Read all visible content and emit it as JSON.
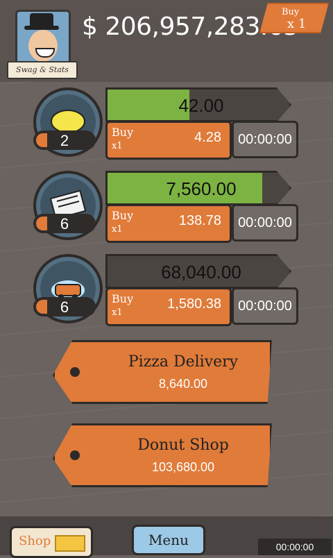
{
  "header": {
    "money": "$ 206,957,283.65",
    "swag_label": "Swag & Stats",
    "buy_multiplier": {
      "label": "Buy",
      "value": "x 1"
    }
  },
  "businesses": [
    {
      "name": "lemon",
      "owned": "2",
      "revenue": "42.00",
      "progress": 0.45,
      "buy_label": "Buy",
      "buy_mult": "x1",
      "cost": "4.28",
      "timer": "00:00:00"
    },
    {
      "name": "newspaper",
      "owned": "6",
      "revenue": "7,560.00",
      "progress": 0.85,
      "buy_label": "Buy",
      "buy_mult": "x1",
      "cost": "138.78",
      "timer": "00:00:00"
    },
    {
      "name": "car-wash",
      "owned": "6",
      "revenue": "68,040.00",
      "progress": 0.0,
      "buy_label": "Buy",
      "buy_mult": "x1",
      "cost": "1,580.38",
      "timer": "00:00:00"
    }
  ],
  "unlockables": [
    {
      "title": "Pizza Delivery",
      "price": "8,640.00"
    },
    {
      "title": "Donut Shop",
      "price": "103,680.00"
    }
  ],
  "footer": {
    "shop_label": "Shop",
    "menu_label": "Menu",
    "timer": "00:00:00"
  },
  "colors": {
    "accent": "#e07b39",
    "progress": "#7cb342",
    "bg": "#6a6360"
  }
}
